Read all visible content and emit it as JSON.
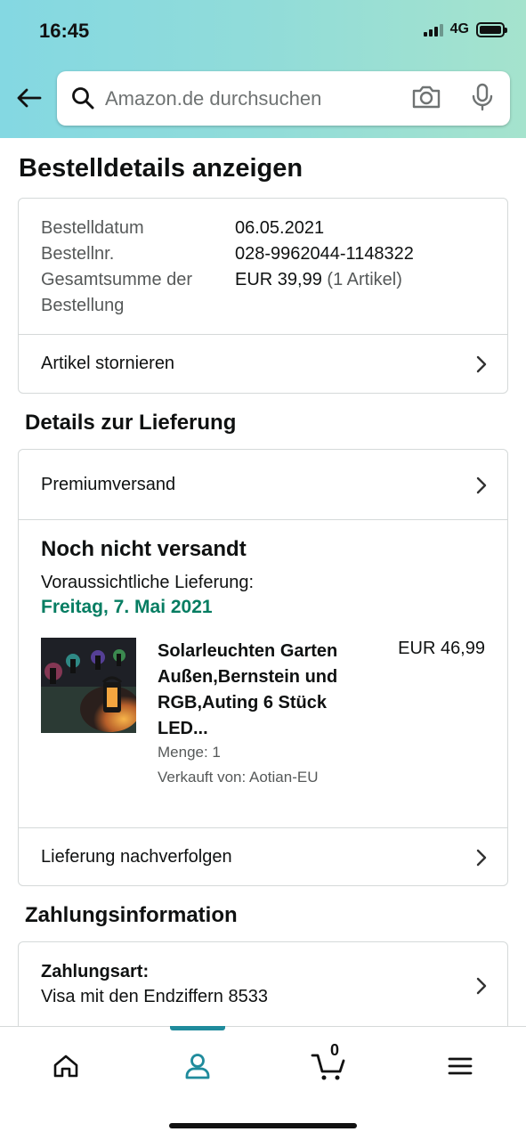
{
  "status_bar": {
    "time": "16:45",
    "network": "4G"
  },
  "search": {
    "placeholder": "Amazon.de durchsuchen"
  },
  "page_title": "Bestelldetails anzeigen",
  "order_summary": {
    "date_label": "Bestelldatum",
    "date_value": "06.05.2021",
    "number_label": "Bestellnr.",
    "number_value": "028-9962044-1148322",
    "total_label_line1": "Gesamtsumme der",
    "total_label_line2": "Bestellung",
    "total_value": "EUR 39,99",
    "total_items": "(1 Artikel)",
    "cancel_label": "Artikel stornieren"
  },
  "delivery": {
    "section_title": "Details zur Lieferung",
    "shipping_method": "Premiumversand",
    "status": "Noch nicht versandt",
    "expected_label": "Voraussichtliche Lieferung:",
    "expected_date": "Freitag, 7. Mai 2021",
    "product": {
      "title_lines": [
        "Solarleuchten Garten",
        "Außen,Bernstein und",
        "RGB,Auting 6 Stück",
        "LED..."
      ],
      "price": "EUR 46,99",
      "quantity": "Menge: 1",
      "seller": "Verkauft von: Aotian-EU"
    },
    "track_label": "Lieferung nachverfolgen"
  },
  "payment": {
    "section_title": "Zahlungsinformation",
    "method_label": "Zahlungsart:",
    "method_value": "Visa mit den Endziffern 8533"
  },
  "bottom_nav": {
    "items": [
      "home-icon",
      "account-icon",
      "cart-icon",
      "menu-icon"
    ],
    "cart_count": "0",
    "active_color": "#1f8b9c"
  },
  "colors": {
    "delivery_date": "#067d62",
    "border": "#d5d9d9",
    "muted_text": "#565959"
  }
}
